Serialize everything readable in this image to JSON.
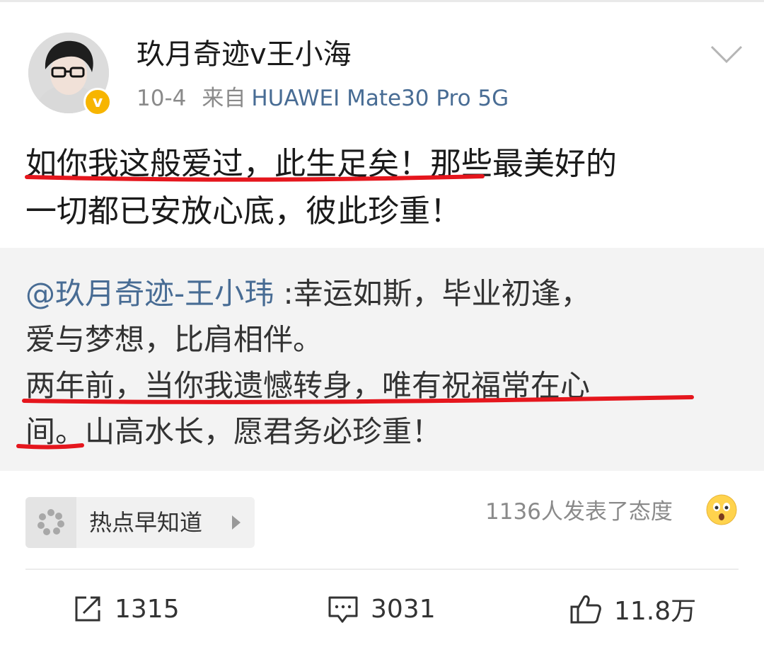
{
  "post": {
    "username": "玖月奇迹v王小海",
    "time": "10-4",
    "source_prefix": "来自",
    "device": "HUAWEI Mate30 Pro 5G",
    "content_line1": "如你我这般爱过，此生足矣！那些最美好的",
    "content_line2": "一切都已安放心底，彼此珍重！"
  },
  "repost": {
    "mention": "@玖月奇迹-王小玮",
    "line1_rest": " :幸运如斯，毕业初逢，",
    "line2": "爱与梦想，比肩相伴。",
    "line3": "两年前，当你我遗憾转身，唯有祝福常在心",
    "line4": "间。山高水长，愿君务必珍重！"
  },
  "topic": {
    "label": "热点早知道"
  },
  "reactions": {
    "text": "1136人发表了态度"
  },
  "actions": {
    "repost_count": "1315",
    "comment_count": "3031",
    "like_count": "11.8万"
  },
  "colors": {
    "link": "#486c94",
    "badge": "#f7b500",
    "annotation": "#e5161d"
  },
  "icons": [
    "chevron-down-icon",
    "verified-badge-icon",
    "topic-icon",
    "arrow-right-icon",
    "wow-emoji-icon",
    "repost-icon",
    "comment-icon",
    "like-icon"
  ]
}
